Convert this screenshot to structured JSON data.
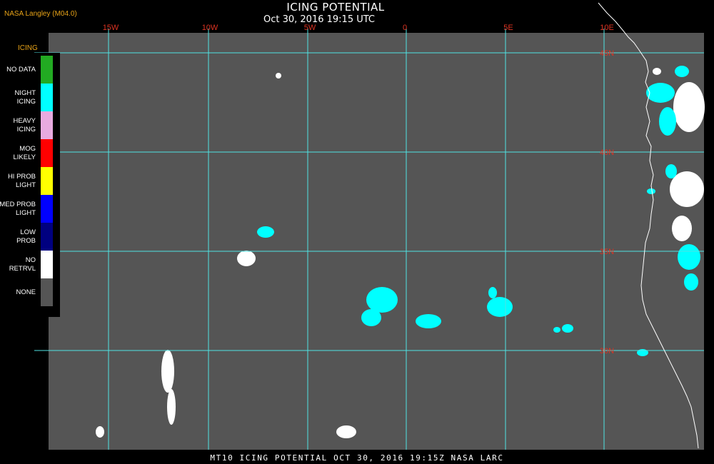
{
  "header": {
    "credit": "NASA Langley (M04.0)",
    "title": "ICING POTENTIAL",
    "timestamp": "Oct 30, 2016 19:15 UTC"
  },
  "map": {
    "background_color": "#555555",
    "grid_color": "#4fe3e3",
    "lon_labels": [
      "15W",
      "10W",
      "5W",
      "0",
      "5E",
      "10E"
    ],
    "lat_labels": [
      "45N",
      "40N",
      "35N",
      "30N"
    ]
  },
  "legend": {
    "title": "ICING",
    "items": [
      {
        "label": "NO DATA",
        "color": "#22aa22"
      },
      {
        "label": "NIGHT\nICING",
        "color": "#00ffff"
      },
      {
        "label": "HEAVY\nICING",
        "color": "#e8aae0"
      },
      {
        "label": "MOG\nLIKELY",
        "color": "#ff0000"
      },
      {
        "label": "HI PROB\nLIGHT",
        "color": "#ffff00"
      },
      {
        "label": "MED PROB\nLIGHT",
        "color": "#0000ff"
      },
      {
        "label": "LOW\nPROB",
        "color": "#000080"
      },
      {
        "label": "NO\nRETRVL",
        "color": "#ffffff"
      },
      {
        "label": "NONE",
        "color": "#555555"
      }
    ]
  },
  "footer": "MT10  ICING POTENTIAL  OCT 30, 2016 19:15Z  NASA LARC"
}
